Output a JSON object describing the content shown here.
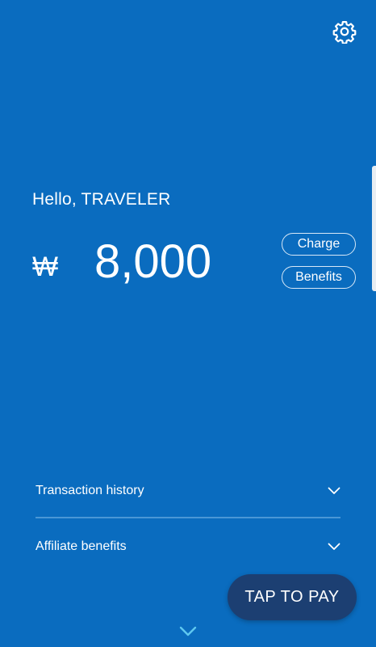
{
  "header": {
    "settings_icon": "gear-icon"
  },
  "account": {
    "greeting": "Hello, TRAVELER",
    "currency_symbol": "₩",
    "balance": "8,000"
  },
  "actions": {
    "charge_label": "Charge",
    "benefits_label": "Benefits"
  },
  "sections": [
    {
      "label": "Transaction history",
      "icon": "chevron-down-icon"
    },
    {
      "label": "Affiliate benefits",
      "icon": "chevron-down-icon"
    }
  ],
  "pay_button": {
    "label": "TAP TO PAY"
  },
  "colors": {
    "background": "#0a6cbf",
    "pay_button": "#1c3f72",
    "divider": "#4a97d6",
    "bottom_chevron": "#5fc8f0"
  }
}
